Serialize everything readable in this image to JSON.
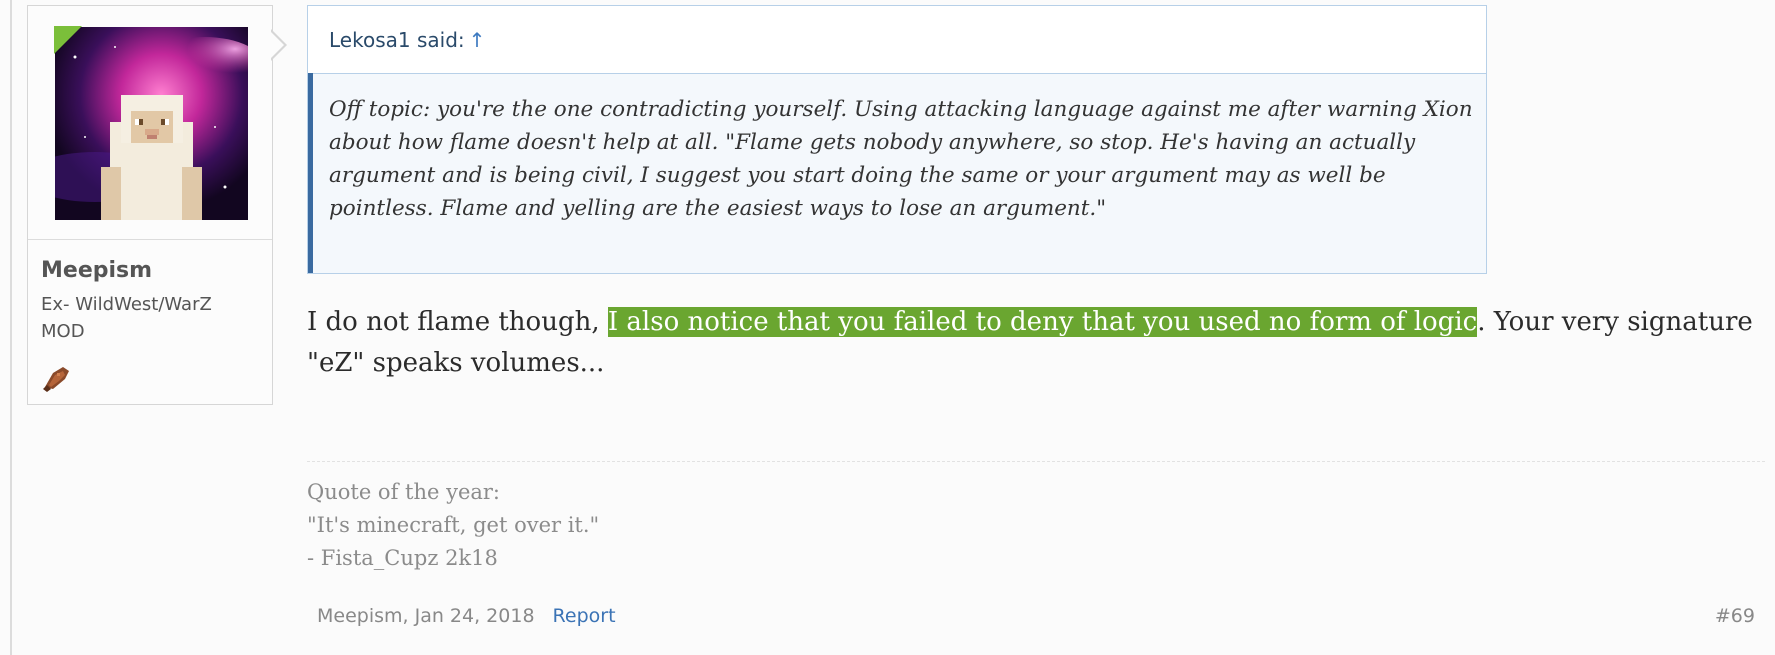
{
  "user": {
    "name": "Meepism",
    "title_lines": [
      "Ex- WildWest/WarZ",
      "MOD"
    ],
    "avatar_icon": "sheep-galaxy-avatar",
    "trophy_icon": "pickaxe-trophy-icon",
    "online_color": "#7bbf3a"
  },
  "quote": {
    "author_said": "Lekosa1 said:",
    "jump_arrow": "↑",
    "text": "Off topic: you're the one contradicting yourself. Using attacking language against me after warning Xion about how flame doesn't help at all. \"Flame gets nobody anywhere, so stop. He's having an actually argument and is being civil, I suggest you start doing the same or your argument may as well be pointless. Flame and yelling are the easiest ways to lose an argument.\""
  },
  "message": {
    "before": "I do not flame though, ",
    "highlighted": "I also notice that you failed to deny that you used no form of logic",
    "after": ". Your very signature \"eZ\" speaks volumes...",
    "highlight_color": "#6aa630"
  },
  "signature": {
    "lines": [
      "Quote of the year:",
      "\"It's minecraft, get over it.\"",
      "- Fista_Cupz 2k18"
    ]
  },
  "footer": {
    "author_date": "Meepism, Jan 24, 2018",
    "report_label": "Report",
    "post_number": "#69"
  }
}
